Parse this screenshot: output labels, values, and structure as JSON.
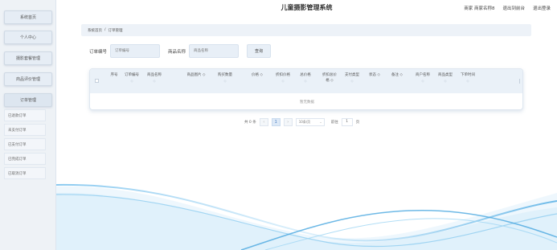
{
  "header": {
    "title": "儿童摄影管理系统",
    "user": "商家 商家名称8",
    "back_to_front": "退出到前台",
    "logout": "退出登录"
  },
  "sidebar": {
    "items": [
      {
        "label": "系统首页"
      },
      {
        "label": "个人中心"
      },
      {
        "label": "摄影套餐管理"
      },
      {
        "label": "商品评价管理"
      },
      {
        "label": "订单管理"
      }
    ],
    "sub_items": [
      {
        "label": "已退款订单"
      },
      {
        "label": "未支付订单"
      },
      {
        "label": "已支付订单"
      },
      {
        "label": "已完成订单"
      },
      {
        "label": "已取消订单"
      }
    ]
  },
  "breadcrumb": {
    "home": "系统首页",
    "separator": "/",
    "current": "订单管理"
  },
  "search": {
    "order_label": "订单编号",
    "order_placeholder": "订单编号",
    "product_label": "商品名称",
    "product_placeholder": "商品名称",
    "search_button": "查询"
  },
  "table": {
    "columns": [
      {
        "line1": "",
        "line2": "序号"
      },
      {
        "line1": "订单编号",
        "line2": "◇"
      },
      {
        "line1": "商品名称",
        "line2": "◇"
      },
      {
        "line1": "",
        "line2": "商品图片 ◇"
      },
      {
        "line1": "购买数量",
        "line2": "◇"
      },
      {
        "line1": "",
        "line2": "价格 ◇"
      },
      {
        "line1": "折扣价格",
        "line2": "◇"
      },
      {
        "line1": "总价格",
        "line2": "◇"
      },
      {
        "line1": "折扣总价",
        "line2": "格 ◇"
      },
      {
        "line1": "支付类型",
        "line2": "◇"
      },
      {
        "line1": "",
        "line2": "状态 ◇"
      },
      {
        "line1": "",
        "line2": "备注 ◇"
      },
      {
        "line1": "商户名称",
        "line2": "◇"
      },
      {
        "line1": "商品类型",
        "line2": "◇"
      },
      {
        "line1": "下单时间",
        "line2": "◇"
      }
    ],
    "empty_text": "暂无数据"
  },
  "pagination": {
    "total": "共 0 条",
    "prev": "‹",
    "current_page": "1",
    "next": "›",
    "page_size": "10条/页",
    "goto_label": "前往",
    "goto_value": "1",
    "page_unit": "页"
  },
  "colors": {
    "accent": "#4a7fc1",
    "sidebar_bg": "#eef2f6",
    "wave": "#5fb3e6"
  }
}
